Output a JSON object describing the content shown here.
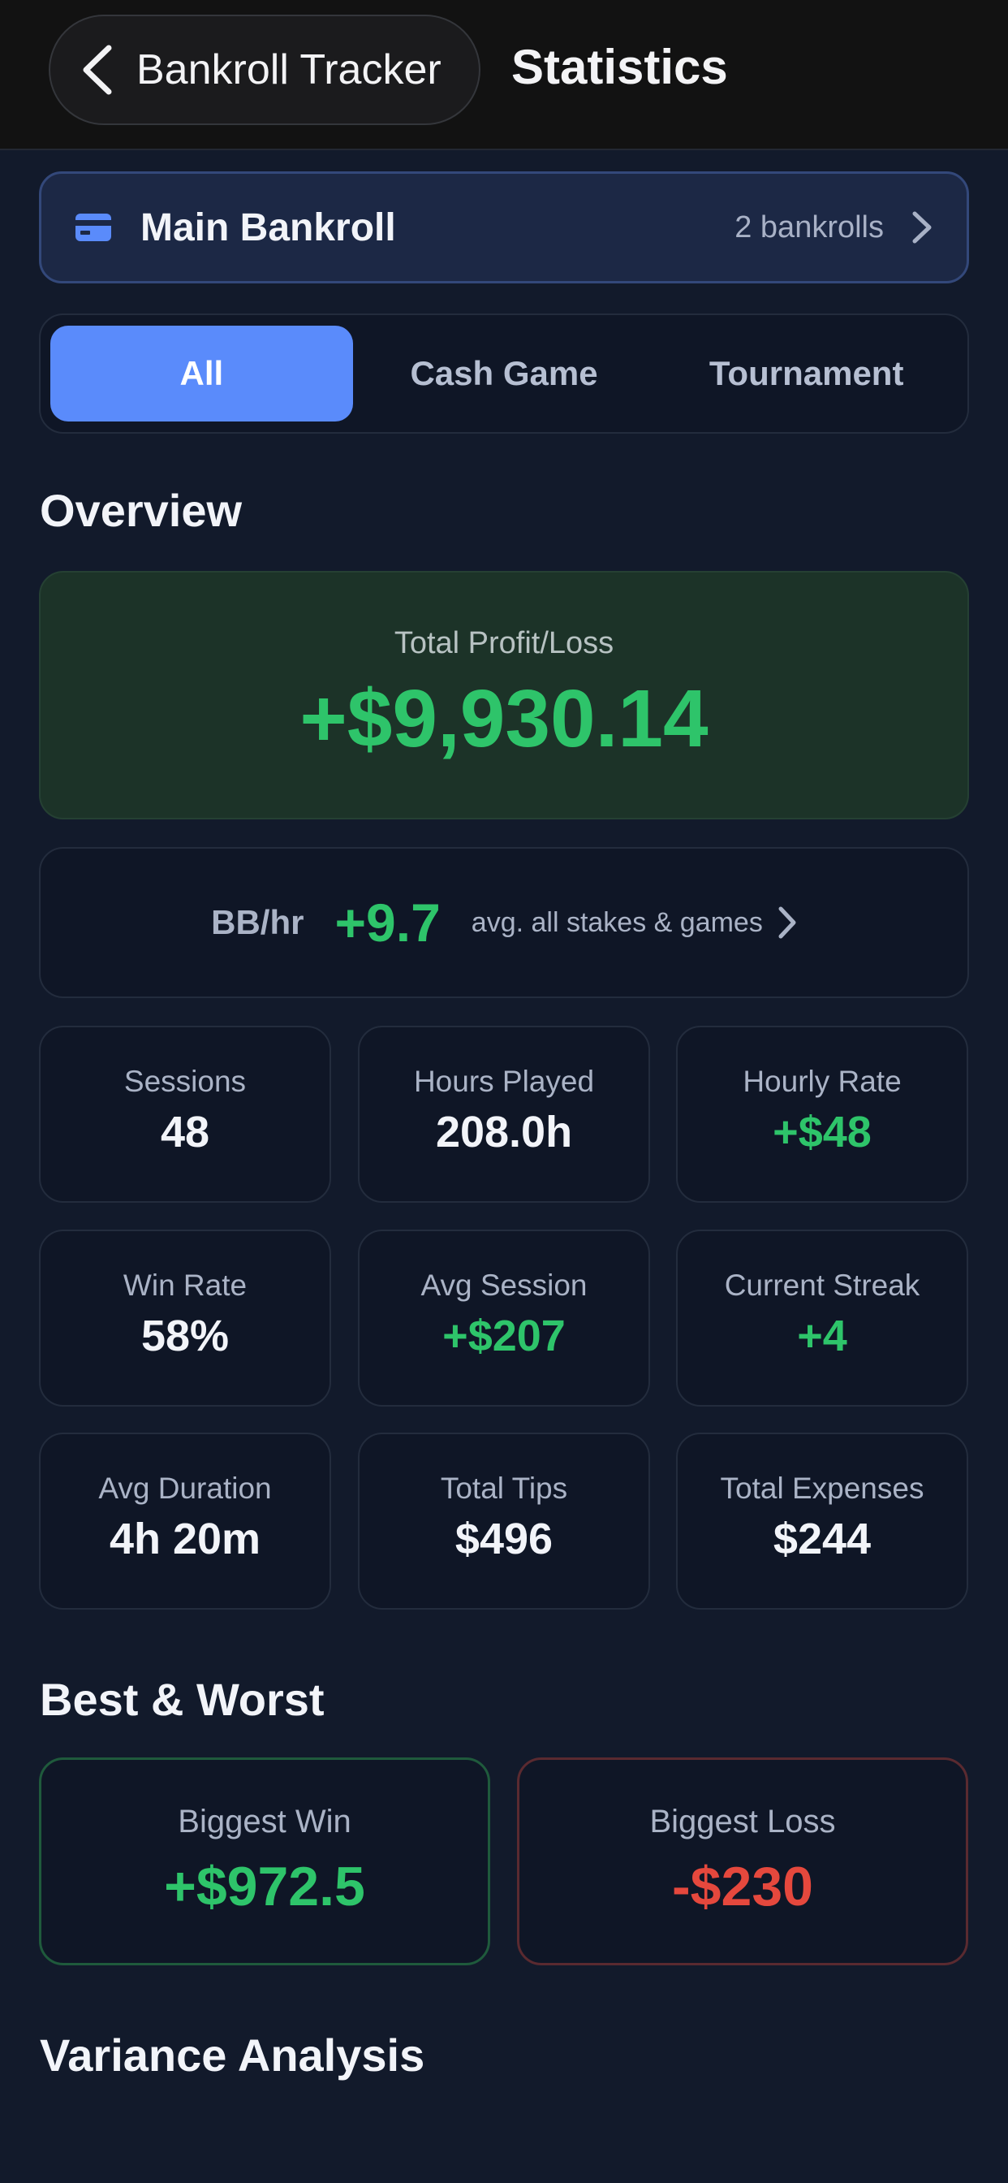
{
  "header": {
    "back_label": "Bankroll Tracker",
    "title": "Statistics"
  },
  "bankroll": {
    "name": "Main Bankroll",
    "count": "2 bankrolls"
  },
  "segments": [
    {
      "label": "All",
      "active": true
    },
    {
      "label": "Cash Game",
      "active": false
    },
    {
      "label": "Tournament",
      "active": false
    }
  ],
  "overview": {
    "title": "Overview",
    "total_label": "Total Profit/Loss",
    "total_value": "+$9,930.14",
    "bb_label": "BB/hr",
    "bb_value": "+9.7",
    "bb_sub": "avg. all stakes & games"
  },
  "stats": [
    {
      "label": "Sessions",
      "value": "48",
      "color": "#f2f4f9"
    },
    {
      "label": "Hours Played",
      "value": "208.0h",
      "color": "#f2f4f9"
    },
    {
      "label": "Hourly Rate",
      "value": "+$48",
      "color": "#2ec46a"
    },
    {
      "label": "Win Rate",
      "value": "58%",
      "color": "#f2f4f9"
    },
    {
      "label": "Avg Session",
      "value": "+$207",
      "color": "#2ec46a"
    },
    {
      "label": "Current Streak",
      "value": "+4",
      "color": "#2ec46a"
    },
    {
      "label": "Avg Duration",
      "value": "4h 20m",
      "color": "#f2f4f9"
    },
    {
      "label": "Total Tips",
      "value": "$496",
      "color": "#f2f4f9"
    },
    {
      "label": "Total Expenses",
      "value": "$244",
      "color": "#f2f4f9"
    }
  ],
  "best_worst": {
    "title": "Best & Worst",
    "win_label": "Biggest Win",
    "win_value": "+$972.5",
    "loss_label": "Biggest Loss",
    "loss_value": "-$230"
  },
  "variance": {
    "title": "Variance Analysis"
  },
  "colors": {
    "accent": "#5a8bfb",
    "positive": "#2ec46a",
    "negative": "#e5483d",
    "background": "#121a2b"
  },
  "icons": {
    "back": "chevron-left-icon",
    "bankroll": "credit-card-icon",
    "bankroll_chevron": "chevron-right-icon",
    "bb_chevron": "chevron-right-icon"
  }
}
